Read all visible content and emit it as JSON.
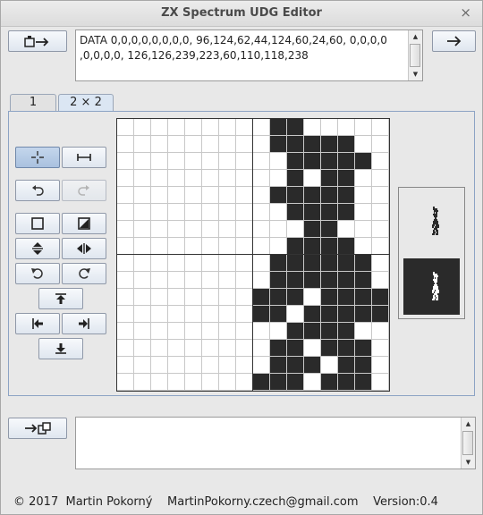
{
  "window": {
    "title": "ZX Spectrum UDG Editor",
    "close_glyph": "×"
  },
  "data_output": {
    "line1": "DATA 0,0,0,0,0,0,0,0, 96,124,62,44,124,60,24,60, 0,0,0,0",
    "line2": ",0,0,0,0, 126,126,239,223,60,110,118,238"
  },
  "tabs": [
    {
      "label": "1",
      "active": false
    },
    {
      "label": "2 × 2",
      "active": true
    }
  ],
  "udg": {
    "top_left": [
      0,
      0,
      0,
      0,
      0,
      0,
      0,
      0
    ],
    "top_right": [
      96,
      124,
      62,
      44,
      124,
      60,
      24,
      60
    ],
    "bottom_left": [
      0,
      0,
      0,
      0,
      0,
      0,
      0,
      0
    ],
    "bottom_right": [
      126,
      126,
      239,
      223,
      60,
      110,
      118,
      238
    ],
    "on_color": "#2a2a2a",
    "off_color": "#ffffff"
  },
  "tools": {
    "move_selected": true,
    "undo_enabled": true,
    "redo_enabled": false
  },
  "input_area": {
    "value": ""
  },
  "footer": {
    "copyright": "© 2017  Martin Pokorný",
    "email": "MartinPokorny.czech@gmail.com",
    "version": "Version:0.4"
  }
}
